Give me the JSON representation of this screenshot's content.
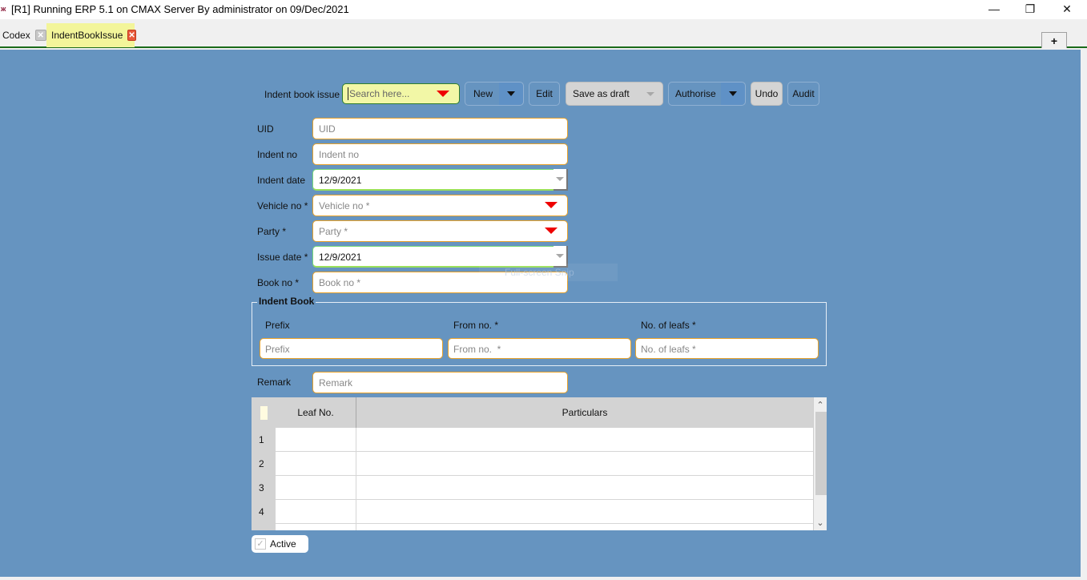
{
  "window": {
    "app_icon": "erp-app-icon",
    "title": "[R1] Running ERP 5.1 on CMAX Server By administrator on 09/Dec/2021",
    "controls": {
      "minimize": "—",
      "maximize": "❐",
      "close": "✕"
    }
  },
  "tabs": [
    {
      "label": "Codex",
      "close": "✕",
      "active": false
    },
    {
      "label": "IndentBookIssue",
      "close": "✕",
      "active": true
    }
  ],
  "add_tab_label": "+",
  "toolbar": {
    "form_label": "Indent book issue",
    "search_placeholder": "Search here...",
    "new_label": "New",
    "edit_label": "Edit",
    "save_draft_label": "Save as draft",
    "authorise_label": "Authorise",
    "undo_label": "Undo",
    "audit_label": "Audit"
  },
  "fields": {
    "uid": {
      "label": "UID",
      "placeholder": "UID",
      "value": ""
    },
    "indent_no": {
      "label": "Indent no",
      "placeholder": "Indent no",
      "value": ""
    },
    "indent_date": {
      "label": "Indent date",
      "value": "12/9/2021"
    },
    "vehicle_no": {
      "label": "Vehicle no *",
      "placeholder": "Vehicle no *",
      "value": ""
    },
    "party": {
      "label": "Party *",
      "placeholder": "Party *",
      "value": ""
    },
    "issue_date": {
      "label": "Issue date *",
      "value": "12/9/2021"
    },
    "book_no": {
      "label": "Book no *",
      "placeholder": "Book no *",
      "value": ""
    },
    "remark": {
      "label": "Remark",
      "placeholder": "Remark",
      "value": ""
    }
  },
  "indent_book": {
    "title": "Indent Book",
    "prefix": {
      "label": "Prefix",
      "placeholder": "Prefix"
    },
    "from_no": {
      "label": "From no.  *",
      "placeholder": "From no.  *"
    },
    "no_of_leafs": {
      "label": "No. of leafs *",
      "placeholder": "No. of leafs *"
    }
  },
  "grid": {
    "columns": [
      "Leaf No.",
      "Particulars"
    ],
    "rows": [
      {
        "num": "1",
        "leaf_no": "",
        "particulars": ""
      },
      {
        "num": "2",
        "leaf_no": "",
        "particulars": ""
      },
      {
        "num": "3",
        "leaf_no": "",
        "particulars": ""
      },
      {
        "num": "4",
        "leaf_no": "",
        "particulars": ""
      }
    ],
    "scroll_up": "⌃",
    "scroll_down": "⌄"
  },
  "active": {
    "label": "Active",
    "checked": true,
    "check_glyph": "✓"
  },
  "overlay_text": "Full-screen Snip"
}
